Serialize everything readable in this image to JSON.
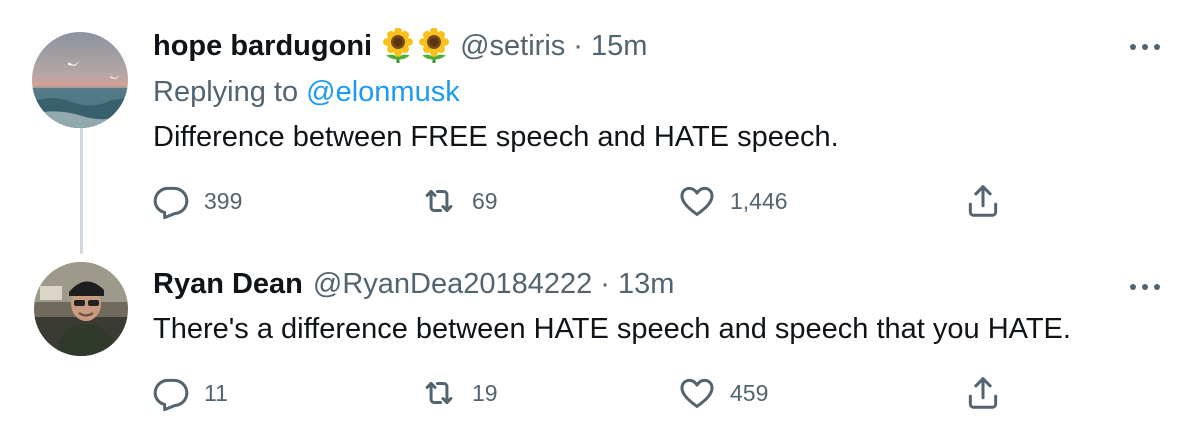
{
  "tweets": [
    {
      "display_name": "hope bardugoni",
      "emojis": [
        "sunflower-emoji",
        "sunflower-emoji"
      ],
      "handle": "@setiris",
      "separator": "·",
      "time": "15m",
      "replying_prefix": "Replying to ",
      "replying_to": "@elonmusk",
      "text": "Difference between FREE speech and HATE speech.",
      "replies": "399",
      "retweets": "69",
      "likes": "1,446"
    },
    {
      "display_name": "Ryan Dean",
      "handle": "@RyanDea20184222",
      "separator": "·",
      "time": "13m",
      "text": "There's a difference between HATE speech and speech that you HATE.",
      "replies": "11",
      "retweets": "19",
      "likes": "459"
    }
  ],
  "colors": {
    "text": "#0f1419",
    "secondary": "#536471",
    "link": "#1d9bf0",
    "thread_line": "#cfd9de"
  },
  "icons": [
    "reply-icon",
    "retweet-icon",
    "like-icon",
    "share-icon",
    "more-icon"
  ]
}
